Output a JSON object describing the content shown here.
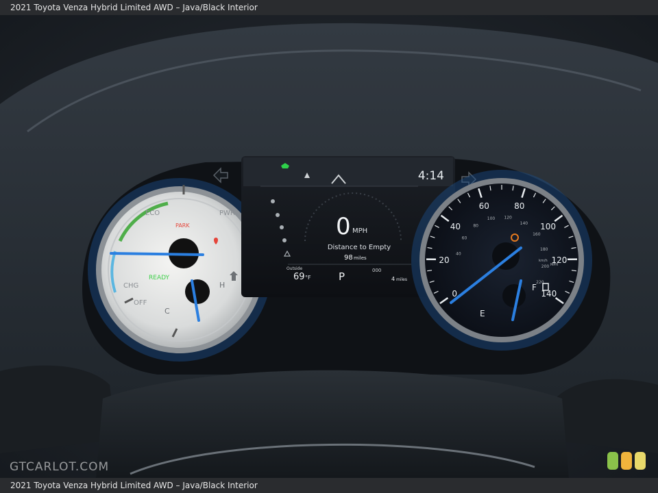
{
  "caption": {
    "top": "2021 Toyota Venza Hybrid Limited AWD – Java/Black Interior",
    "bottom": "2021 Toyota Venza Hybrid Limited AWD – Java/Black Interior"
  },
  "watermark": "GTCARLOT.COM",
  "cluster": {
    "left_gauge": {
      "eco": "ECO",
      "pwr": "PWR",
      "chg": "CHG",
      "off": "OFF",
      "park": "PARK",
      "ready": "READY",
      "cold": "C",
      "hot": "H"
    },
    "display": {
      "clock": "4:14",
      "speed": "0",
      "speed_unit": "MPH",
      "dte_label": "Distance to Empty",
      "dte_value": "98",
      "dte_unit": "miles",
      "outside_label": "Outside",
      "outside_temp": "69",
      "temp_unit": "°F",
      "gear": "P",
      "odo": "000",
      "trip": "4",
      "trip_unit": "miles"
    },
    "speedometer": {
      "major_ticks": [
        "0",
        "20",
        "40",
        "60",
        "80",
        "100",
        "120",
        "140"
      ],
      "minor_ticks": [
        "40",
        "60",
        "80",
        "100",
        "120",
        "140",
        "160",
        "180",
        "200",
        "220"
      ],
      "unit_kmh": "km/h",
      "unit_mph": "MPH",
      "speed_value_mph": 0
    },
    "fuel_gauge": {
      "empty": "E",
      "full": "F"
    }
  }
}
